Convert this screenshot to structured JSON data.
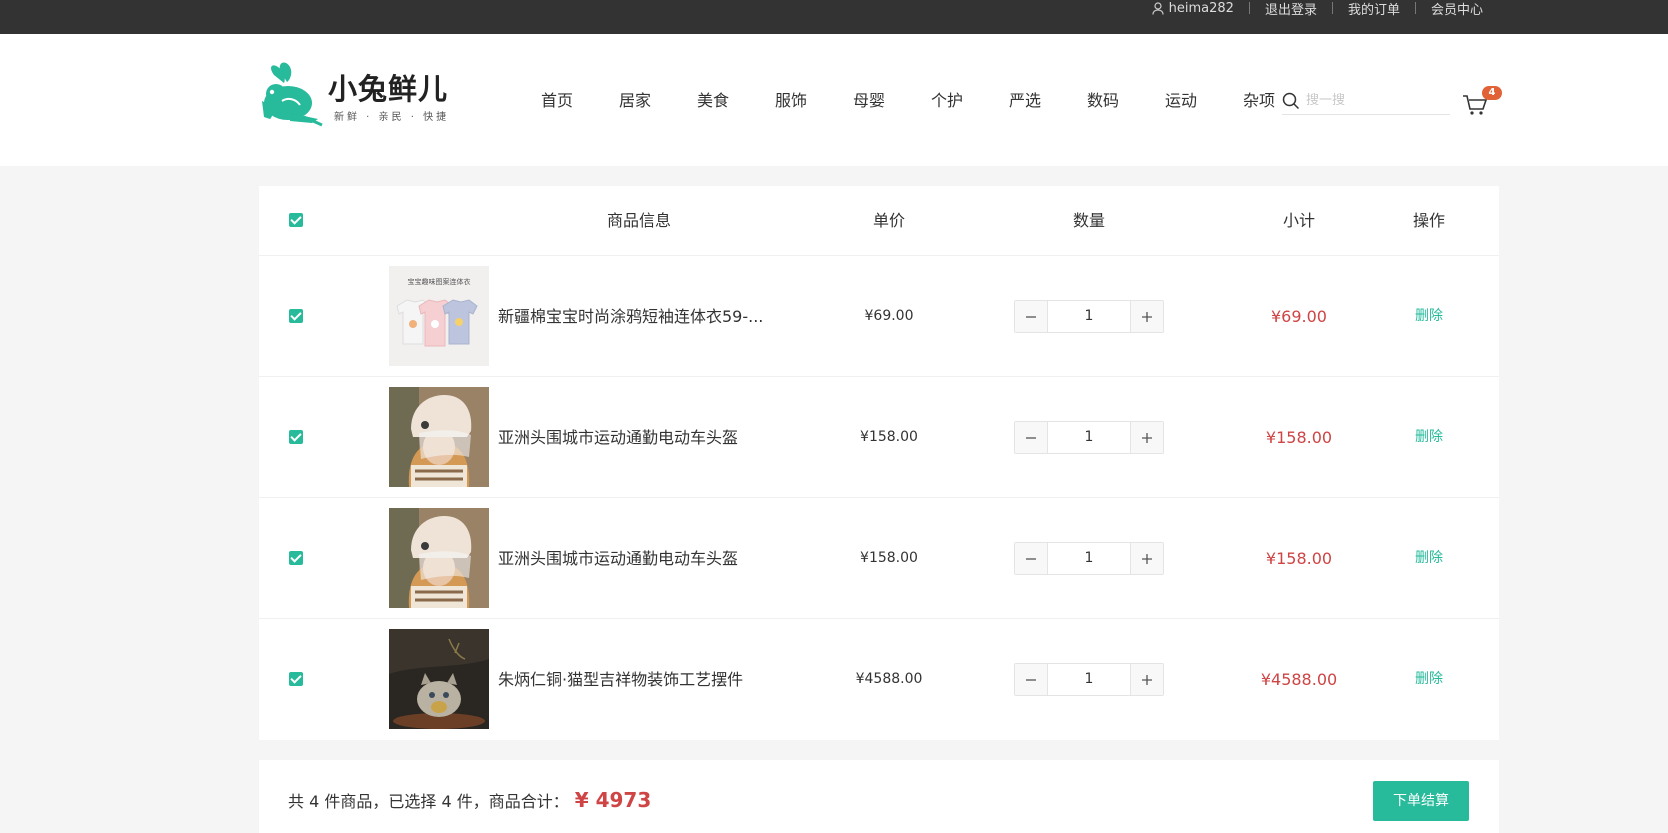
{
  "topbar": {
    "username": "heima282",
    "logout": "退出登录",
    "orders": "我的订单",
    "member_center": "会员中心"
  },
  "header": {
    "logo_name": "小兔鲜儿",
    "logo_slogan": "新鲜 · 亲民 · 快捷",
    "nav": [
      "首页",
      "居家",
      "美食",
      "服饰",
      "母婴",
      "个护",
      "严选",
      "数码",
      "运动",
      "杂项"
    ],
    "search_placeholder": "搜一搜",
    "cart_count": "4"
  },
  "table": {
    "headers": {
      "info": "商品信息",
      "price": "单价",
      "quantity": "数量",
      "subtotal": "小计",
      "action": "操作"
    },
    "rows": [
      {
        "name": "新疆棉宝宝时尚涂鸦短袖连体衣59-...",
        "price": "¥69.00",
        "qty": "1",
        "subtotal": "¥69.00",
        "action": "删除",
        "image_caption": "宝宝趣味图案连体衣"
      },
      {
        "name": "亚洲头围城市运动通勤电动车头盔",
        "price": "¥158.00",
        "qty": "1",
        "subtotal": "¥158.00",
        "action": "删除"
      },
      {
        "name": "亚洲头围城市运动通勤电动车头盔",
        "price": "¥158.00",
        "qty": "1",
        "subtotal": "¥158.00",
        "action": "删除"
      },
      {
        "name": "朱炳仁铜·猫型吉祥物装饰工艺摆件",
        "price": "¥4588.00",
        "qty": "1",
        "subtotal": "¥4588.00",
        "action": "删除"
      }
    ]
  },
  "summary": {
    "text": "共 4 件商品，已选择 4 件，商品合计：",
    "total": "¥ 4973",
    "checkout": "下单结算"
  },
  "colors": {
    "brand": "#27ba9b",
    "price_red": "#cf4444",
    "badge": "#e26237",
    "topbar": "#333333"
  }
}
